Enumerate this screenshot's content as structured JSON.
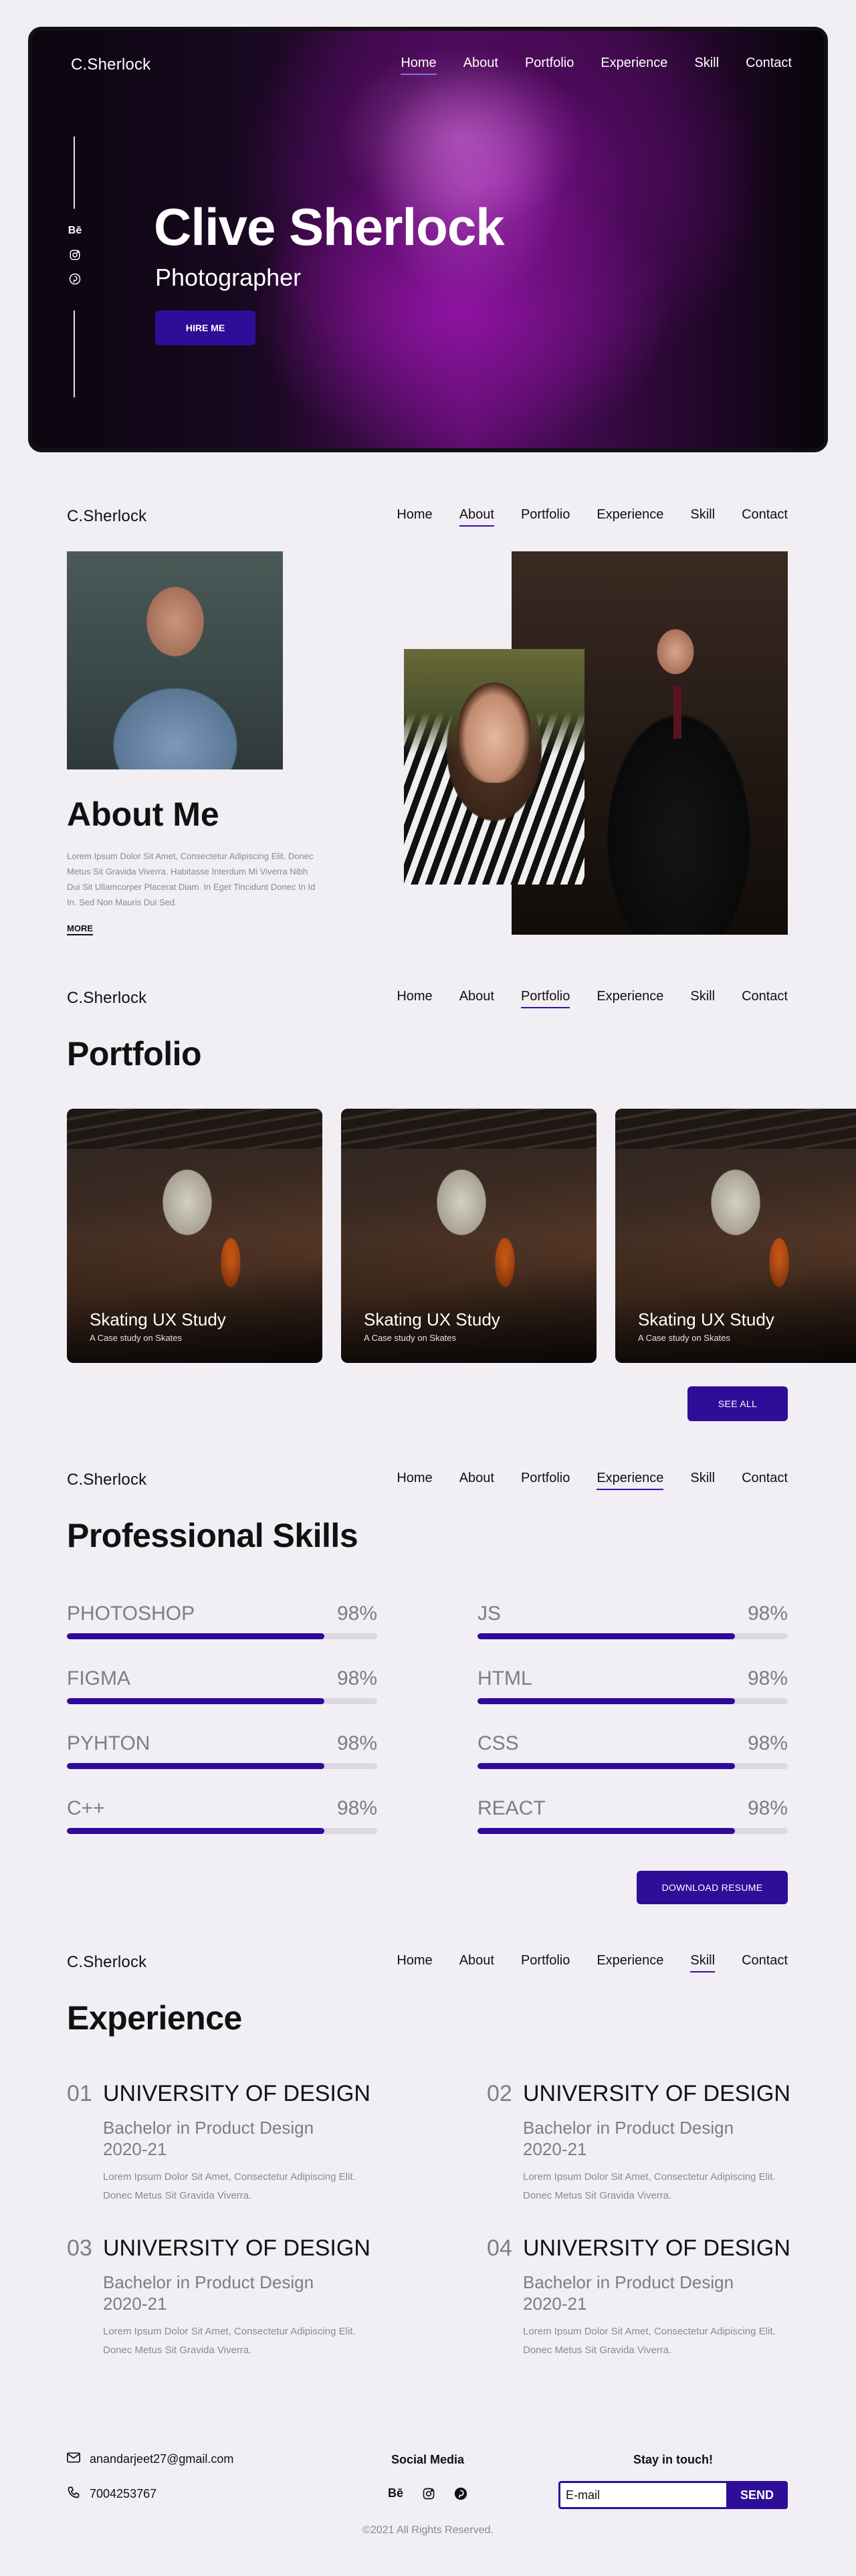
{
  "colors": {
    "accent": "#2e0e98",
    "background": "#f1eef4",
    "muted_text": "#7f7c85"
  },
  "brand": "C.Sherlock",
  "menu": [
    "Home",
    "About",
    "Portfolio",
    "Experience",
    "Skill",
    "Contact"
  ],
  "hero": {
    "title": "Clive Sherlock",
    "subtitle": "Photographer",
    "hire_label": "HIRE ME",
    "social_icons": [
      "behance-icon",
      "instagram-icon",
      "pinterest-icon"
    ],
    "behance_text": "Bē"
  },
  "about": {
    "title": "About Me",
    "text": "Lorem Ipsum Dolor Sit Amet, Consectetur Adipiscing Elit. Donec Metus Sit Gravida Viverra. Habitasse Interdum Mi Viverra Nibh Dui Sit Ullamcorper Placerat Diam. In Eget Tincidunt Donec In Id In. Sed Non Mauris Dui Sed.",
    "more_label": "MORE"
  },
  "portfolio": {
    "title": "Portfolio",
    "cards": [
      {
        "title": "Skating UX Study",
        "subtitle": "A Case study on Skates"
      },
      {
        "title": "Skating UX Study",
        "subtitle": "A Case study on Skates"
      },
      {
        "title": "Skating UX Study",
        "subtitle": "A Case study on Skates"
      }
    ],
    "see_all_label": "SEE ALL"
  },
  "skills": {
    "title": "Professional Skills",
    "items": [
      {
        "name": "PHOTOSHOP",
        "percent": "98%",
        "level": 0.83
      },
      {
        "name": "JS",
        "percent": "98%",
        "level": 0.83
      },
      {
        "name": "FIGMA",
        "percent": "98%",
        "level": 0.83
      },
      {
        "name": "HTML",
        "percent": "98%",
        "level": 0.83
      },
      {
        "name": "PYHTON",
        "percent": "98%",
        "level": 0.83
      },
      {
        "name": "CSS",
        "percent": "98%",
        "level": 0.83
      },
      {
        "name": "C++",
        "percent": "98%",
        "level": 0.83
      },
      {
        "name": "REACT",
        "percent": "98%",
        "level": 0.83
      }
    ],
    "download_label": "DOWNLOAD RESUME"
  },
  "experience": {
    "title": "Experience",
    "items": [
      {
        "num": "01",
        "title": "UNIVERSITY OF DESIGN",
        "degree": "Bachelor in Product Design",
        "years": "2020-21",
        "desc": "Lorem Ipsum Dolor Sit Amet, Consectetur Adipiscing Elit. Donec Metus Sit Gravida Viverra."
      },
      {
        "num": "02",
        "title": "UNIVERSITY OF DESIGN",
        "degree": "Bachelor in Product Design",
        "years": "2020-21",
        "desc": "Lorem Ipsum Dolor Sit Amet, Consectetur Adipiscing Elit. Donec Metus Sit Gravida Viverra."
      },
      {
        "num": "03",
        "title": "UNIVERSITY OF DESIGN",
        "degree": "Bachelor in Product Design",
        "years": "2020-21",
        "desc": "Lorem Ipsum Dolor Sit Amet, Consectetur Adipiscing Elit. Donec Metus Sit Gravida Viverra."
      },
      {
        "num": "04",
        "title": "UNIVERSITY OF DESIGN",
        "degree": "Bachelor in Product Design",
        "years": "2020-21",
        "desc": "Lorem Ipsum Dolor Sit Amet, Consectetur Adipiscing Elit. Donec Metus Sit Gravida Viverra."
      }
    ]
  },
  "footer": {
    "email": "anandarjeet27@gmail.com",
    "phone": "7004253767",
    "social_title": "Social Media",
    "stay_title": "Stay in touch!",
    "email_placeholder": "E-mail",
    "send_label": "SEND",
    "copyright": "©2021 All Rights Reserved."
  }
}
